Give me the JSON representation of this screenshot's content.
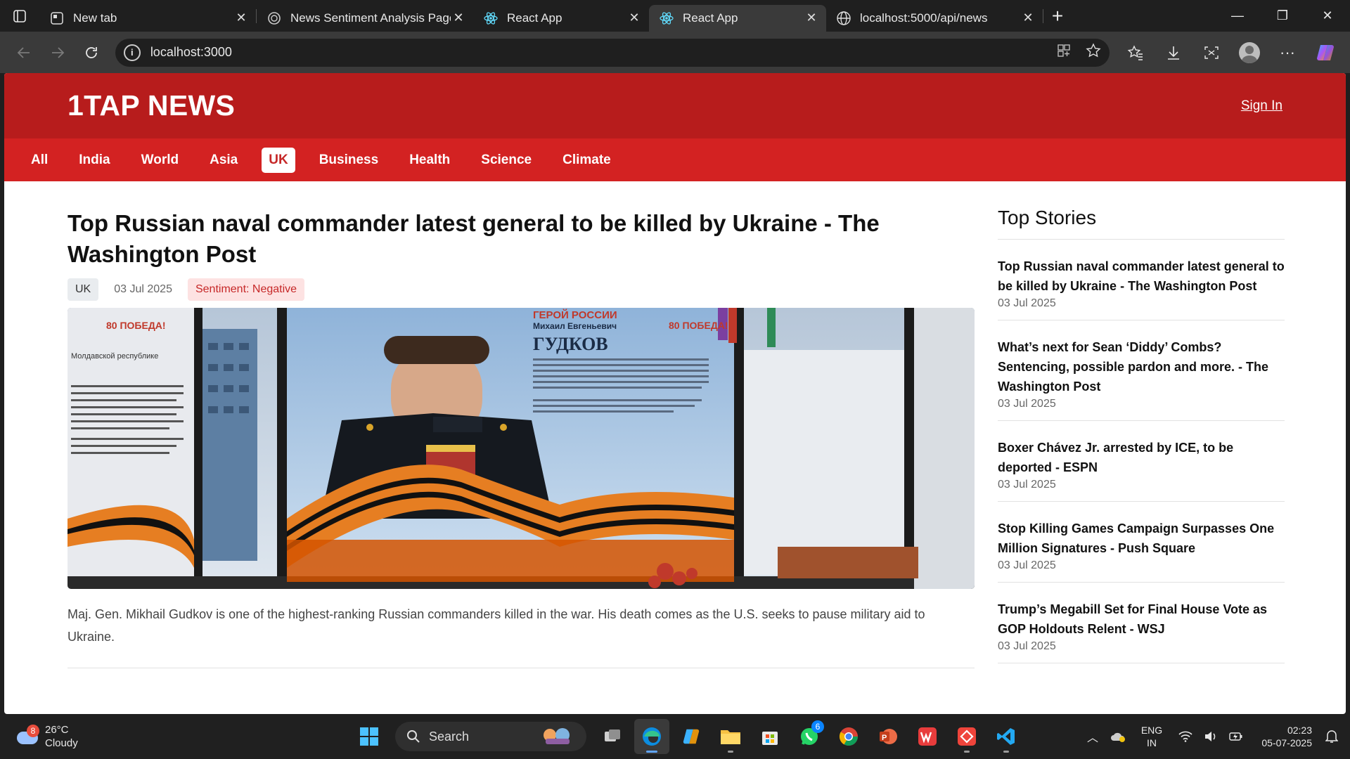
{
  "browser": {
    "tabs": [
      {
        "title": "New tab",
        "icon": "newtab-icon"
      },
      {
        "title": "News Sentiment Analysis Page",
        "icon": "openai-icon"
      },
      {
        "title": "React App",
        "icon": "react-icon"
      },
      {
        "title": "React App",
        "icon": "react-icon",
        "active": true
      },
      {
        "title": "localhost:5000/api/news",
        "icon": "globe-icon"
      }
    ],
    "url": "localhost:3000"
  },
  "site": {
    "logo": "1TAP NEWS",
    "signin": "Sign In",
    "categories": [
      "All",
      "India",
      "World",
      "Asia",
      "UK",
      "Business",
      "Health",
      "Science",
      "Climate"
    ],
    "active_category": "UK",
    "accent": "#b71c1c",
    "nav_color": "#d32222"
  },
  "article": {
    "headline": "Top Russian naval commander latest general to be killed by Ukraine - The Washington Post",
    "category_badge": "UK",
    "date": "03 Jul 2025",
    "sentiment": "Sentiment: Negative",
    "description": "Maj. Gen. Mikhail Gudkov is one of the highest-ranking Russian commanders killed in the war. His death comes as the U.S. seeks to pause military aid to Ukraine.",
    "image": {
      "banner_title": "ГЕРОЙ РОССИИ",
      "banner_name": "Михаил Евгеньевич",
      "banner_surname": "ГУДКОВ",
      "left_badge": "80 ПОБЕДА!",
      "right_badge": "80 ПОБЕДА!",
      "left_heading": "Молдавской республике"
    }
  },
  "sidebar": {
    "title": "Top Stories",
    "stories": [
      {
        "title": "Top Russian naval commander latest general to be killed by Ukraine - The Washington Post",
        "date": "03 Jul 2025"
      },
      {
        "title": "What’s next for Sean ‘Diddy’ Combs? Sentencing, possible pardon and more. - The Washington Post",
        "date": "03 Jul 2025"
      },
      {
        "title": "Boxer Chávez Jr. arrested by ICE, to be deported - ESPN",
        "date": "03 Jul 2025"
      },
      {
        "title": "Stop Killing Games Campaign Surpasses One Million Signatures - Push Square",
        "date": "03 Jul 2025"
      },
      {
        "title": "Trump’s Megabill Set for Final House Vote as GOP Holdouts Relent - WSJ",
        "date": "03 Jul 2025"
      }
    ]
  },
  "taskbar": {
    "weather_badge": "8",
    "temperature": "26°C",
    "condition": "Cloudy",
    "search_placeholder": "Search",
    "whatsapp_badge": "6",
    "lang_line1": "ENG",
    "lang_line2": "IN",
    "time": "02:23",
    "date": "05-07-2025"
  }
}
